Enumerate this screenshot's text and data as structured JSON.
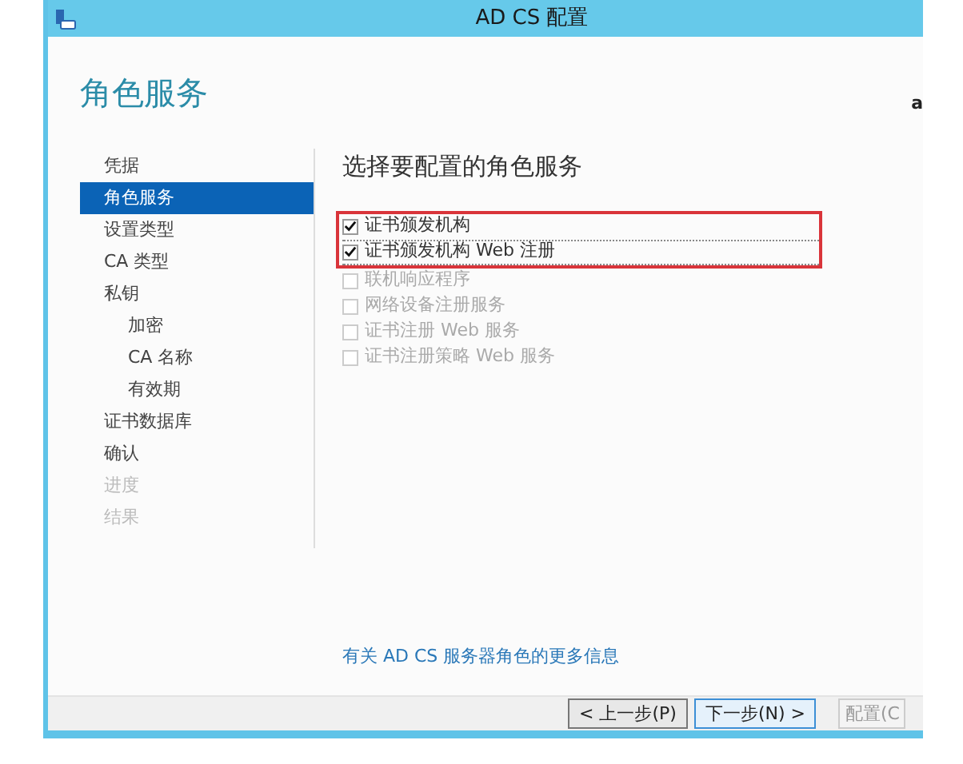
{
  "window": {
    "title": "AD CS 配置"
  },
  "page_title": "角色服务",
  "server_name": "a",
  "sidebar": {
    "items": [
      {
        "label": "凭据",
        "selected": false,
        "disabled": false
      },
      {
        "label": "角色服务",
        "selected": true,
        "disabled": false
      },
      {
        "label": "设置类型",
        "selected": false,
        "disabled": false
      },
      {
        "label": "CA 类型",
        "selected": false,
        "disabled": false
      },
      {
        "label": "私钥",
        "selected": false,
        "disabled": false,
        "children": [
          {
            "label": "加密",
            "selected": false,
            "disabled": false
          },
          {
            "label": "CA 名称",
            "selected": false,
            "disabled": false
          },
          {
            "label": "有效期",
            "selected": false,
            "disabled": false
          }
        ]
      },
      {
        "label": "证书数据库",
        "selected": false,
        "disabled": false
      },
      {
        "label": "确认",
        "selected": false,
        "disabled": false
      },
      {
        "label": "进度",
        "selected": false,
        "disabled": true
      },
      {
        "label": "结果",
        "selected": false,
        "disabled": true
      }
    ]
  },
  "main": {
    "heading": "选择要配置的角色服务",
    "services": [
      {
        "label": "证书颁发机构",
        "checked": true,
        "disabled": false,
        "highlighted": true,
        "focused": false
      },
      {
        "label": "证书颁发机构 Web 注册",
        "checked": true,
        "disabled": false,
        "highlighted": true,
        "focused": true
      },
      {
        "label": "联机响应程序",
        "checked": false,
        "disabled": true,
        "highlighted": false,
        "focused": false
      },
      {
        "label": "网络设备注册服务",
        "checked": false,
        "disabled": true,
        "highlighted": false,
        "focused": false
      },
      {
        "label": "证书注册 Web 服务",
        "checked": false,
        "disabled": true,
        "highlighted": false,
        "focused": false
      },
      {
        "label": "证书注册策略 Web 服务",
        "checked": false,
        "disabled": true,
        "highlighted": false,
        "focused": false
      }
    ],
    "link": "有关 AD CS 服务器角色的更多信息"
  },
  "buttons": [
    {
      "label": "< 上一步(P)",
      "kind": "prev",
      "disabled": false
    },
    {
      "label": "下一步(N) >",
      "kind": "default",
      "disabled": false
    },
    {
      "label": "配置(C",
      "kind": "plain",
      "disabled": true
    }
  ]
}
